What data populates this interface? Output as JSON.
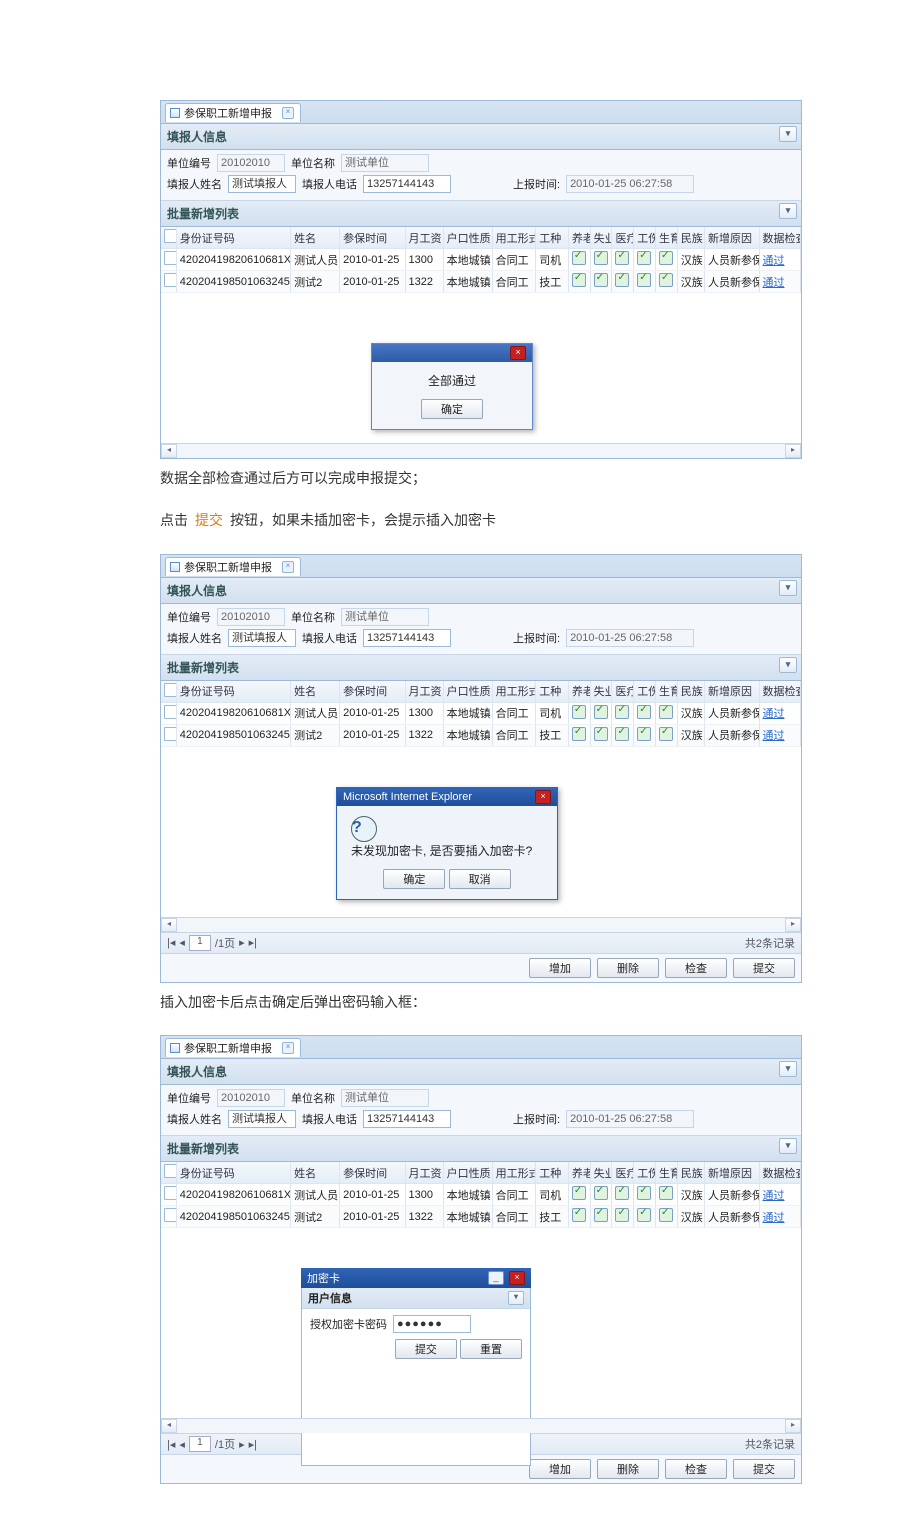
{
  "tab": {
    "title": "参保职工新增申报"
  },
  "sections": {
    "reporter": "填报人信息",
    "batch": "批量新增列表"
  },
  "form": {
    "unit_no_label": "单位编号",
    "unit_no": "20102010",
    "unit_name_label": "单位名称",
    "unit_name": "测试单位",
    "reporter_label": "填报人姓名",
    "reporter": "测试填报人",
    "phone_label": "填报人电话",
    "phone": "13257144143",
    "time_label": "上报时间:",
    "time": "2010-01-25 06:27:58"
  },
  "cols": {
    "id": "身份证号码",
    "name": "姓名",
    "join": "参保时间",
    "salary": "月工资",
    "hukou": "户口性质",
    "employ": "用工形式",
    "job": "工种",
    "yanglao": "养老",
    "shiye": "失业",
    "yiliao": "医疗",
    "gongshang": "工伤",
    "shengyu": "生育",
    "minzu": "民族",
    "reason": "新增原因",
    "check": "数据检查"
  },
  "rows": [
    {
      "id": "42020419820610681X",
      "name": "测试人员",
      "join": "2010-01-25",
      "salary": "1300",
      "hukou": "本地城镇",
      "employ": "合同工",
      "job": "司机",
      "minzu": "汉族",
      "reason": "人员新参保",
      "check": "通过"
    },
    {
      "id": "420204198501063245",
      "name": "测试2",
      "join": "2010-01-25",
      "salary": "1322",
      "hukou": "本地城镇",
      "employ": "合同工",
      "job": "技工",
      "minzu": "汉族",
      "reason": "人员新参保",
      "check": "通过"
    }
  ],
  "modal_allpass": {
    "text": "全部通过",
    "ok": "确定"
  },
  "modal_ie": {
    "title": "Microsoft Internet Explorer",
    "msg": "未发现加密卡, 是否要插入加密卡?",
    "ok": "确定",
    "cancel": "取消"
  },
  "pager": {
    "text": "/1页",
    "total": "共2条记录"
  },
  "toolbar": {
    "add": "增加",
    "del": "删除",
    "check": "检查",
    "submit": "提交"
  },
  "enc": {
    "win_title": "加密卡",
    "sub": "用户信息",
    "pwd_label": "授权加密卡密码",
    "pwd_mask": "●●●●●●",
    "submit": "提交",
    "reset": "重置"
  },
  "captions": {
    "c1": "数据全部检查通过后方可以完成申报提交；",
    "c2_a": "点击",
    "c2_b": "提交",
    "c2_c": "按钮，如果未插加密卡，会提示插入加密卡",
    "c3": "插入加密卡后点击确定后弹出密码输入框："
  }
}
